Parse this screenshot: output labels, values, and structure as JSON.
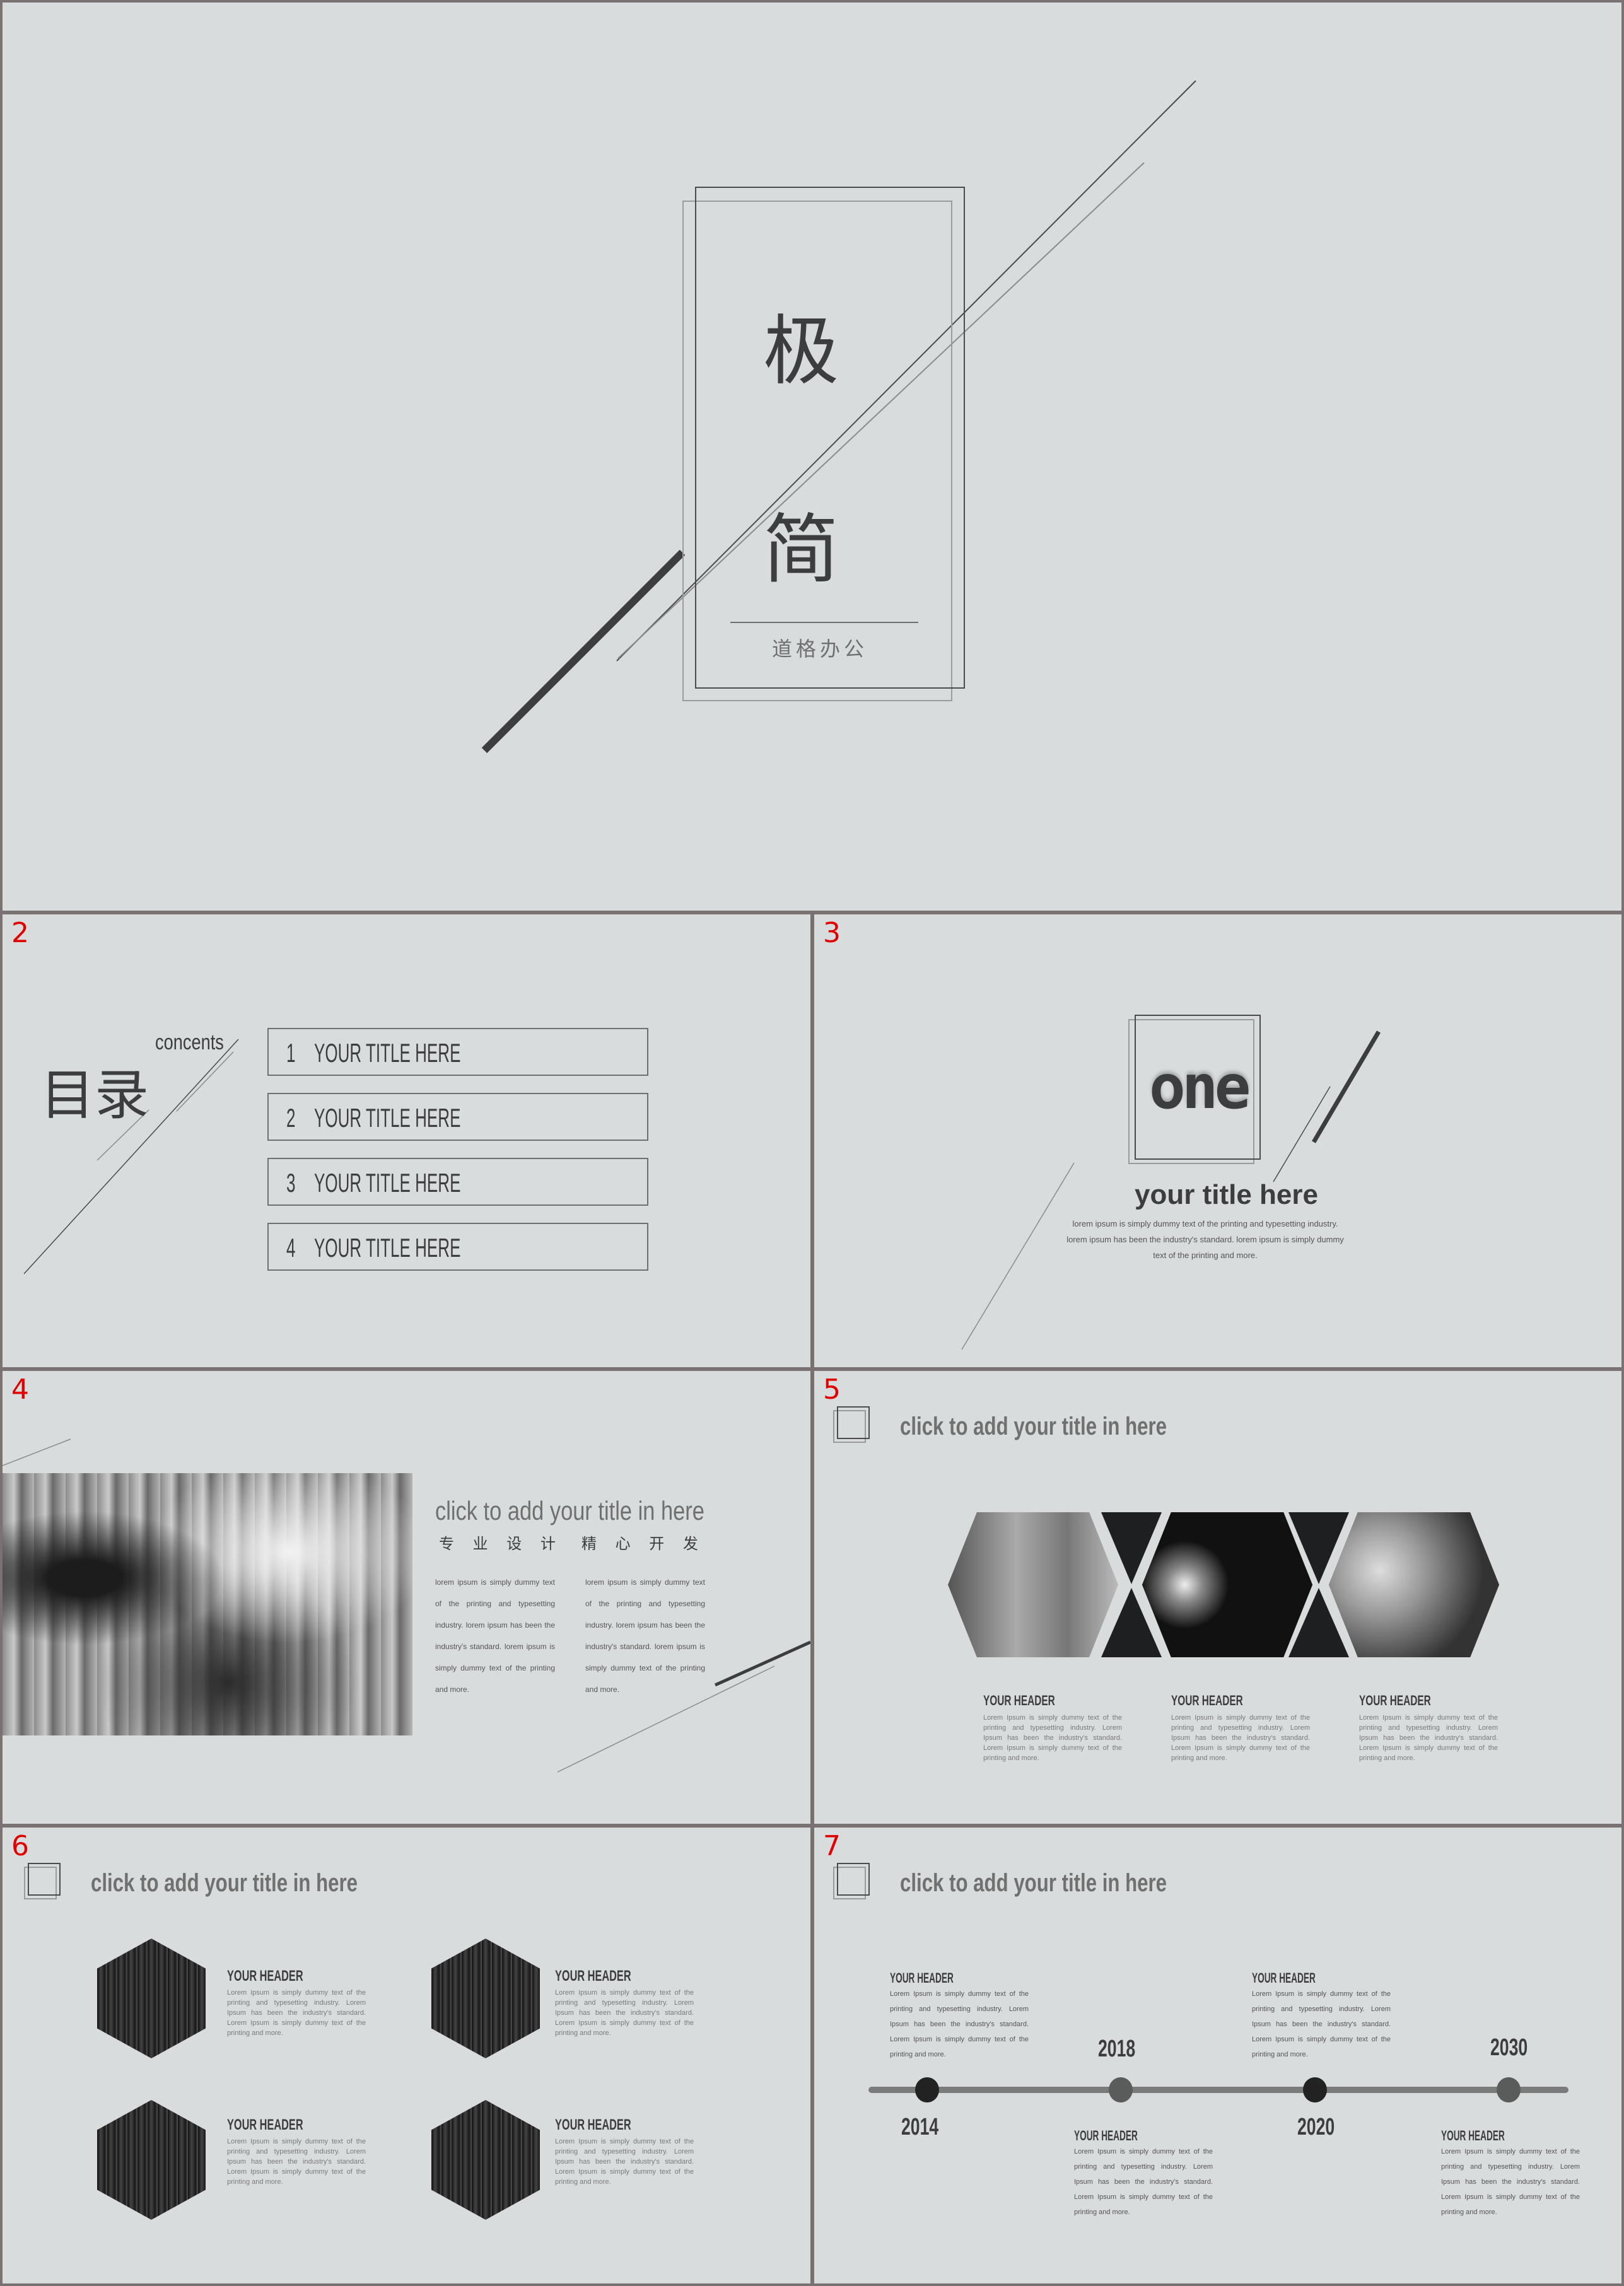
{
  "slides": {
    "s1": {
      "char1": "极",
      "char2": "简",
      "subtitle": "道格办公"
    },
    "s2": {
      "number": "2",
      "title_cn": "目录",
      "title_en": "concents",
      "items": [
        {
          "num": "1",
          "label": "YOUR TITLE HERE"
        },
        {
          "num": "2",
          "label": "YOUR TITLE HERE"
        },
        {
          "num": "3",
          "label": "YOUR TITLE HERE"
        },
        {
          "num": "4",
          "label": "YOUR TITLE HERE"
        }
      ]
    },
    "s3": {
      "number": "3",
      "big": "one",
      "title": "your title here",
      "body_lines": [
        "lorem ipsum is simply dummy text of the printing and typesetting industry.",
        "lorem ipsum has been the industry's standard. lorem ipsum is simply dummy",
        "text of the printing and more."
      ]
    },
    "s4": {
      "number": "4",
      "title": "click to add your title in here",
      "cn_left": "专 业 设 计",
      "cn_right": "精 心 开 发",
      "col_left": "lorem ipsum is simply dummy text of the printing and typesetting industry. lorem ipsum has been the industry's standard. lorem ipsum is simply dummy text of the printing and more.",
      "col_right": "lorem ipsum is simply dummy text of the printing and typesetting industry. lorem ipsum has been the industry's standard. lorem ipsum is simply dummy text of the printing and more."
    },
    "s5": {
      "number": "5",
      "title": "click to add your title in here",
      "cards": [
        {
          "header": "YOUR HEADER",
          "text": "Lorem Ipsum is simply dummy text of the printing and typesetting industry. Lorem Ipsum has been the industry's standard. Lorem Ipsum is simply dummy text of the printing and more."
        },
        {
          "header": "YOUR HEADER",
          "text": "Lorem Ipsum is simply dummy text of the printing and typesetting industry. Lorem Ipsum has been the industry's standard. Lorem Ipsum is simply dummy text of the printing and more."
        },
        {
          "header": "YOUR HEADER",
          "text": "Lorem Ipsum is simply dummy text of the printing and typesetting industry. Lorem Ipsum has been the industry's standard. Lorem Ipsum is simply dummy text of the printing and more."
        }
      ]
    },
    "s6": {
      "number": "6",
      "title": "click to add your title in here",
      "cards": [
        {
          "header": "YOUR HEADER",
          "text": "Lorem Ipsum is simply dummy text of the printing and typesetting industry. Lorem Ipsum has been the industry's standard. Lorem Ipsum is simply dummy text of the printing and more."
        },
        {
          "header": "YOUR HEADER",
          "text": "Lorem Ipsum is simply dummy text of the printing and typesetting industry. Lorem Ipsum has been the industry's standard. Lorem Ipsum is simply dummy text of the printing and more."
        },
        {
          "header": "YOUR HEADER",
          "text": "Lorem Ipsum is simply dummy text of the printing and typesetting industry. Lorem Ipsum has been the industry's standard. Lorem Ipsum is simply dummy text of the printing and more."
        },
        {
          "header": "YOUR HEADER",
          "text": "Lorem Ipsum is simply dummy text of the printing and typesetting industry. Lorem Ipsum has been the industry's standard. Lorem Ipsum is simply dummy text of the printing and more."
        }
      ]
    },
    "s7": {
      "number": "7",
      "title": "click to add your title in here",
      "years": [
        "2014",
        "2018",
        "2020",
        "2030"
      ],
      "cards": [
        {
          "header": "YOUR HEADER",
          "text": "Lorem Ipsum is simply dummy text of the printing and typesetting industry. Lorem Ipsum has been the industry's standard. Lorem Ipsum is simply dummy text of the printing and more."
        },
        {
          "header": "YOUR HEADER",
          "text": "Lorem Ipsum is simply dummy text of the printing and typesetting industry. Lorem Ipsum has been the industry's standard. Lorem Ipsum is simply dummy text of the printing and more."
        },
        {
          "header": "YOUR HEADER",
          "text": "Lorem Ipsum is simply dummy text of the printing and typesetting industry. Lorem Ipsum has been the industry's standard. Lorem Ipsum is simply dummy text of the printing and more."
        },
        {
          "header": "YOUR HEADER",
          "text": "Lorem Ipsum is simply dummy text of the printing and typesetting industry. Lorem Ipsum has been the industry's standard. Lorem Ipsum is simply dummy text of the printing and more."
        }
      ]
    }
  },
  "colors": {
    "slide_bg": "#d8dcdc",
    "frame": "#7a7173",
    "ink": "#3c3d3e",
    "number": "#e00000"
  }
}
